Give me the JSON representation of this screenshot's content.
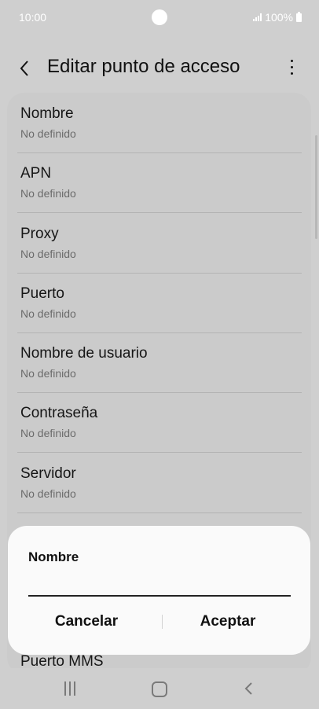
{
  "status_bar": {
    "time": "10:00",
    "battery": "100%"
  },
  "app_bar": {
    "title": "Editar punto de acceso"
  },
  "items": [
    {
      "label": "Nombre",
      "value": "No definido"
    },
    {
      "label": "APN",
      "value": "No definido"
    },
    {
      "label": "Proxy",
      "value": "No definido"
    },
    {
      "label": "Puerto",
      "value": "No definido"
    },
    {
      "label": "Nombre de usuario",
      "value": "No definido"
    },
    {
      "label": "Contraseña",
      "value": "No definido"
    },
    {
      "label": "Servidor",
      "value": "No definido"
    },
    {
      "label": "Puerto MMS",
      "value": ""
    }
  ],
  "dialog": {
    "title": "Nombre",
    "input_value": "",
    "cancel_label": "Cancelar",
    "accept_label": "Aceptar"
  },
  "colors": {
    "dimmed_background": "#cfcfcf",
    "dialog_background": "#fafafa",
    "text_primary": "#111111",
    "text_secondary": "#6b6b6b"
  },
  "icons": {
    "back": "arrow-left-icon",
    "more": "more-vertical-icon",
    "nav_recent": "recent-apps-icon",
    "nav_home": "home-icon",
    "nav_back": "chevron-left-icon"
  }
}
